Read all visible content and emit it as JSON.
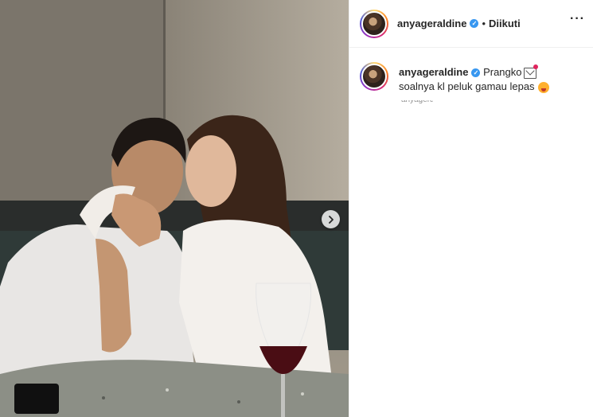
{
  "post": {
    "username": "anyageraldine",
    "follow_status": "Diikuti",
    "separator": "•",
    "caption_line1": "Prangko",
    "caption_line2": "soalnya kl peluk gamau lepas",
    "caption_emoji1": "envelope-heart-icon",
    "caption_emoji2": "tongue-face-icon"
  },
  "colors": {
    "verified_blue": "#3897f0",
    "border": "#efefef",
    "text": "#262626"
  }
}
